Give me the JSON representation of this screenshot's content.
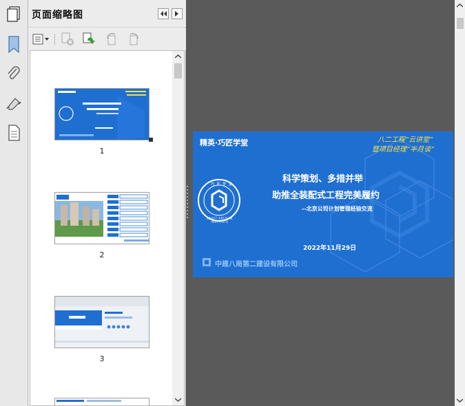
{
  "panel": {
    "title": "页面缩略图"
  },
  "icons": {
    "rail": [
      "page-thumbnails-icon",
      "bookmarks-icon",
      "attachments-icon",
      "signatures-icon",
      "layers-icon"
    ],
    "toolbar": [
      "options-menu-icon",
      "delete-page-icon",
      "insert-page-icon",
      "rotate-left-icon",
      "rotate-right-icon"
    ]
  },
  "thumbnails": [
    {
      "number": "1"
    },
    {
      "number": "2"
    },
    {
      "number": "3"
    }
  ],
  "slide": {
    "brand": "精英·巧匠学堂",
    "title_line1": "科学策划、多措并举",
    "title_line2": "助推全装配式工程完美履约",
    "subtitle": "--北京公司计划管理经验交流",
    "date": "2022年11月29日",
    "company": "中建八局第二建设有限公司",
    "slogan_line1": "八二工程“云讲堂”",
    "slogan_line2": "暨项目经理“半月谈”",
    "seal_text_top": "巧 匠 学 堂",
    "seal_text_bottom": "CRAFT ARTISAN INSTITUTE"
  },
  "thumb2": {
    "menu": [
      "项目概况",
      "工程特点",
      "计划管理",
      "经验总结",
      "质量管控",
      "安全管理",
      "成本控制",
      "总结展望"
    ]
  },
  "thumb3": {
    "section": "第一部分",
    "contents": "CONTENTS"
  },
  "colors": {
    "slide_blue": "#1f6fd1",
    "accent_yellow": "#f5e04a",
    "panel_bg": "#f0f0f0",
    "viewer_bg": "#5a5a5a"
  }
}
